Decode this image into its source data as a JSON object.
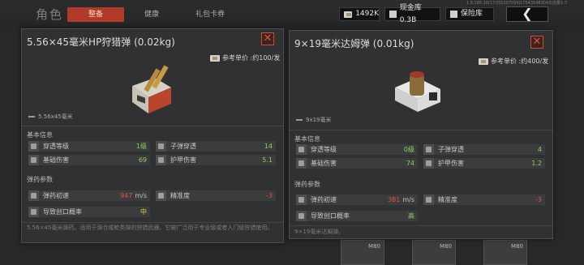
{
  "header": {
    "title": "角色",
    "tabs": [
      {
        "label": "整备",
        "active": true
      },
      {
        "label": "健康",
        "active": false
      },
      {
        "label": "礼包卡券",
        "active": false
      }
    ],
    "currency": {
      "amount": "1492K"
    },
    "cash_vault": {
      "label": "现金库 0.3B"
    },
    "safe": {
      "label": "保险库"
    },
    "back_glyph": "❮",
    "debug": "1.8.165.16(17)|55207034|175435483043|流量1:7"
  },
  "panel_left": {
    "title": "5.56×45毫米HP狩猎弹 (0.02kg)",
    "price": "参考单价 :约100/发",
    "caliber": "5.56x45毫米",
    "basic_section": "基本信息",
    "basic": [
      {
        "label": "穿透等级",
        "value": "1级",
        "color": "green"
      },
      {
        "label": "子弹穿透",
        "value": "14",
        "color": "green"
      },
      {
        "label": "基础伤害",
        "value": "69",
        "color": "green"
      },
      {
        "label": "护甲伤害",
        "value": "5.1",
        "color": "green"
      }
    ],
    "ammo_section": "弹药参数",
    "ammo": [
      {
        "label": "弹药初速",
        "value": "947",
        "unit": "m/s",
        "color": "red"
      },
      {
        "label": "精准度",
        "value": "-3",
        "color": "red"
      },
      {
        "label": "导致创口概率",
        "value": "中",
        "color": "yellow"
      }
    ],
    "description": "5.56×45毫米弹药。适用于弹仓或枪类弹的狩猎武器。它被广泛用于专业级或者入门级狩猎使用。"
  },
  "panel_right": {
    "title": "9×19毫米达姆弹 (0.01kg)",
    "price": "参考单价 :约400/发",
    "caliber": "9x19毫米",
    "basic_section": "基本信息",
    "basic": [
      {
        "label": "穿透等级",
        "value": "0级",
        "color": "green"
      },
      {
        "label": "子弹穿透",
        "value": "4",
        "color": "green"
      },
      {
        "label": "基础伤害",
        "value": "74",
        "color": "green"
      },
      {
        "label": "护甲伤害",
        "value": "1.2",
        "color": "green"
      }
    ],
    "ammo_section": "弹药参数",
    "ammo": [
      {
        "label": "弹药初速",
        "value": "381",
        "unit": "m/s",
        "color": "red"
      },
      {
        "label": "精准度",
        "value": "-3",
        "color": "red"
      },
      {
        "label": "导致创口概率",
        "value": "高",
        "color": "green"
      }
    ],
    "description": "9×19毫米达姆弹。"
  },
  "bg_slots": [
    "M80",
    "M80",
    "M80"
  ],
  "colors": {
    "accent_red": "#b23a28",
    "green": "#8dd15d",
    "yellow": "#e2d03b",
    "red": "#e5533a"
  }
}
